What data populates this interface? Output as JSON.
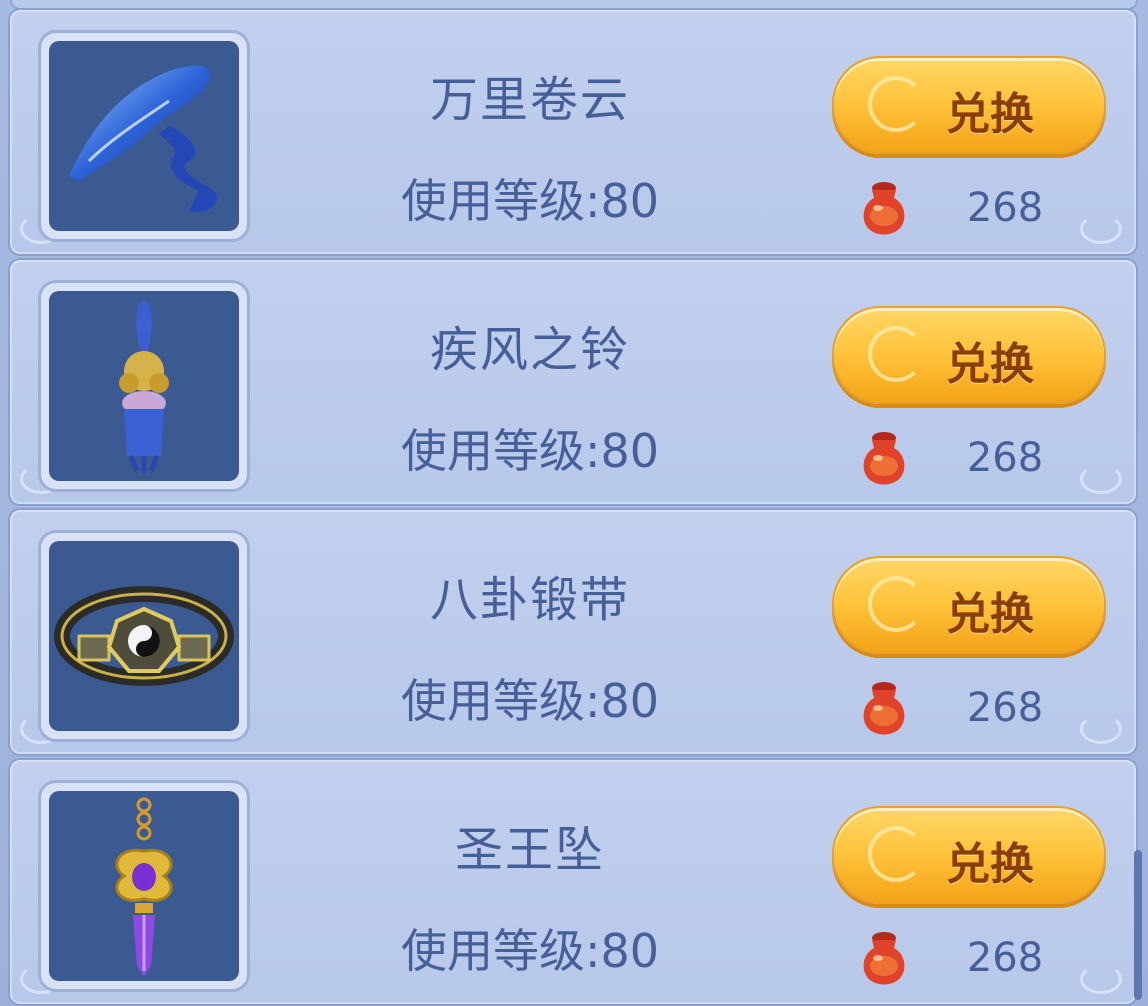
{
  "items": [
    {
      "name": "万里卷云",
      "level": "使用等级:80",
      "button": "兑换",
      "price": "268",
      "icon": "ribbon-item-icon"
    },
    {
      "name": "疾风之铃",
      "level": "使用等级:80",
      "button": "兑换",
      "price": "268",
      "icon": "bell-pendant-item-icon"
    },
    {
      "name": "八卦锻带",
      "level": "使用等级:80",
      "button": "兑换",
      "price": "268",
      "icon": "bagua-belt-item-icon"
    },
    {
      "name": "圣王坠",
      "level": "使用等级:80",
      "button": "兑换",
      "price": "268",
      "icon": "amethyst-pendant-item-icon"
    }
  ],
  "currency_icon": "red-pot-currency-icon",
  "colors": {
    "button": "#ffc23a",
    "text": "#465f99",
    "panel": "#bccbec"
  }
}
